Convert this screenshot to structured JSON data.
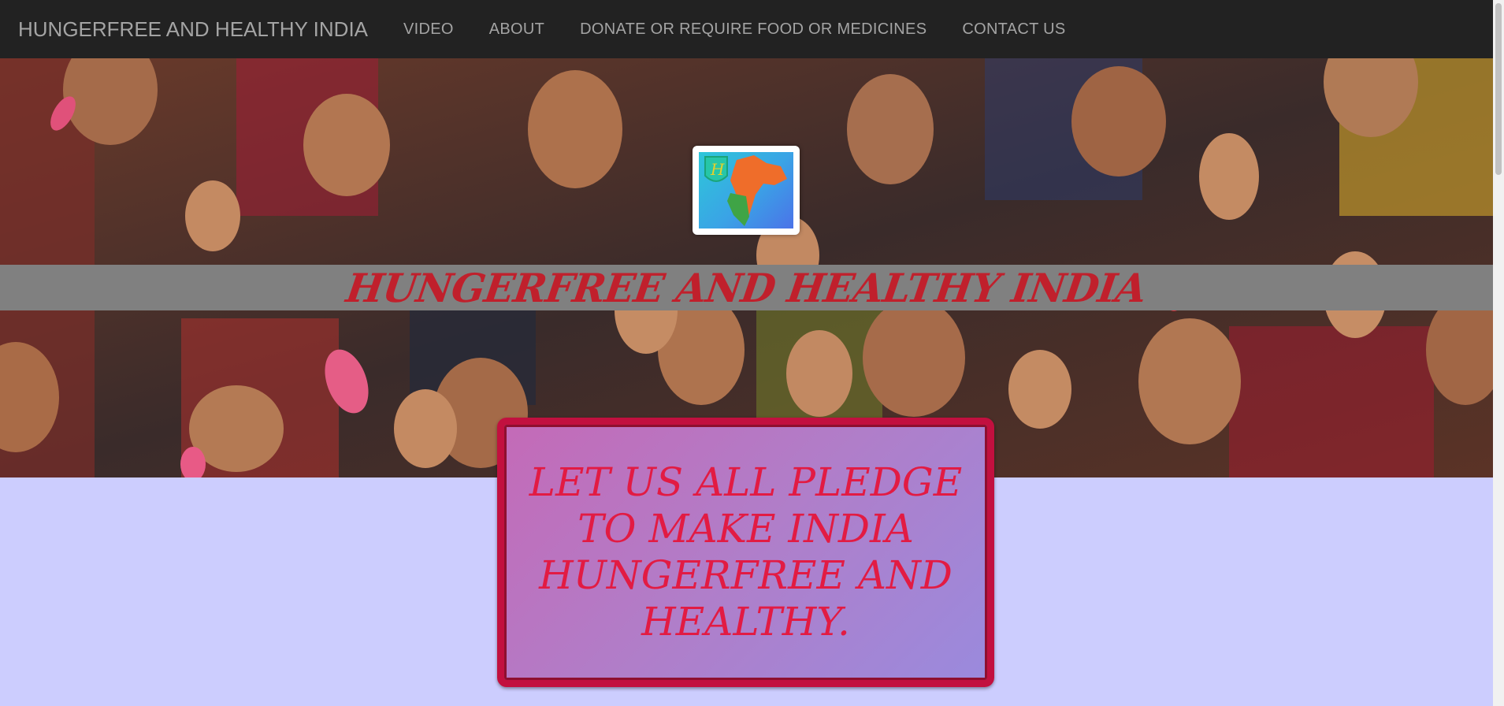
{
  "navbar": {
    "brand": "HUNGERFREE AND HEALTHY INDIA",
    "links": [
      "VIDEO",
      "ABOUT",
      "DONATE OR REQUIRE FOOD OR MEDICINES",
      "CONTACT US"
    ]
  },
  "hero": {
    "banner_title": "HUNGERFREE AND HEALTHY INDIA",
    "logo_letter": "H"
  },
  "pledge": {
    "text": "LET US ALL PLEDGE TO MAKE INDIA HUNGERFREE AND HEALTHY."
  },
  "colors": {
    "navbar_bg": "#222222",
    "nav_text": "#a4a4a4",
    "page_bg": "#cccdfe",
    "band_bg": "#808080",
    "banner_title": "#c0202c",
    "pledge_border": "#c2103f",
    "pledge_text": "#e21b43"
  },
  "icons": {
    "logo": "india-map-shield-logo"
  }
}
